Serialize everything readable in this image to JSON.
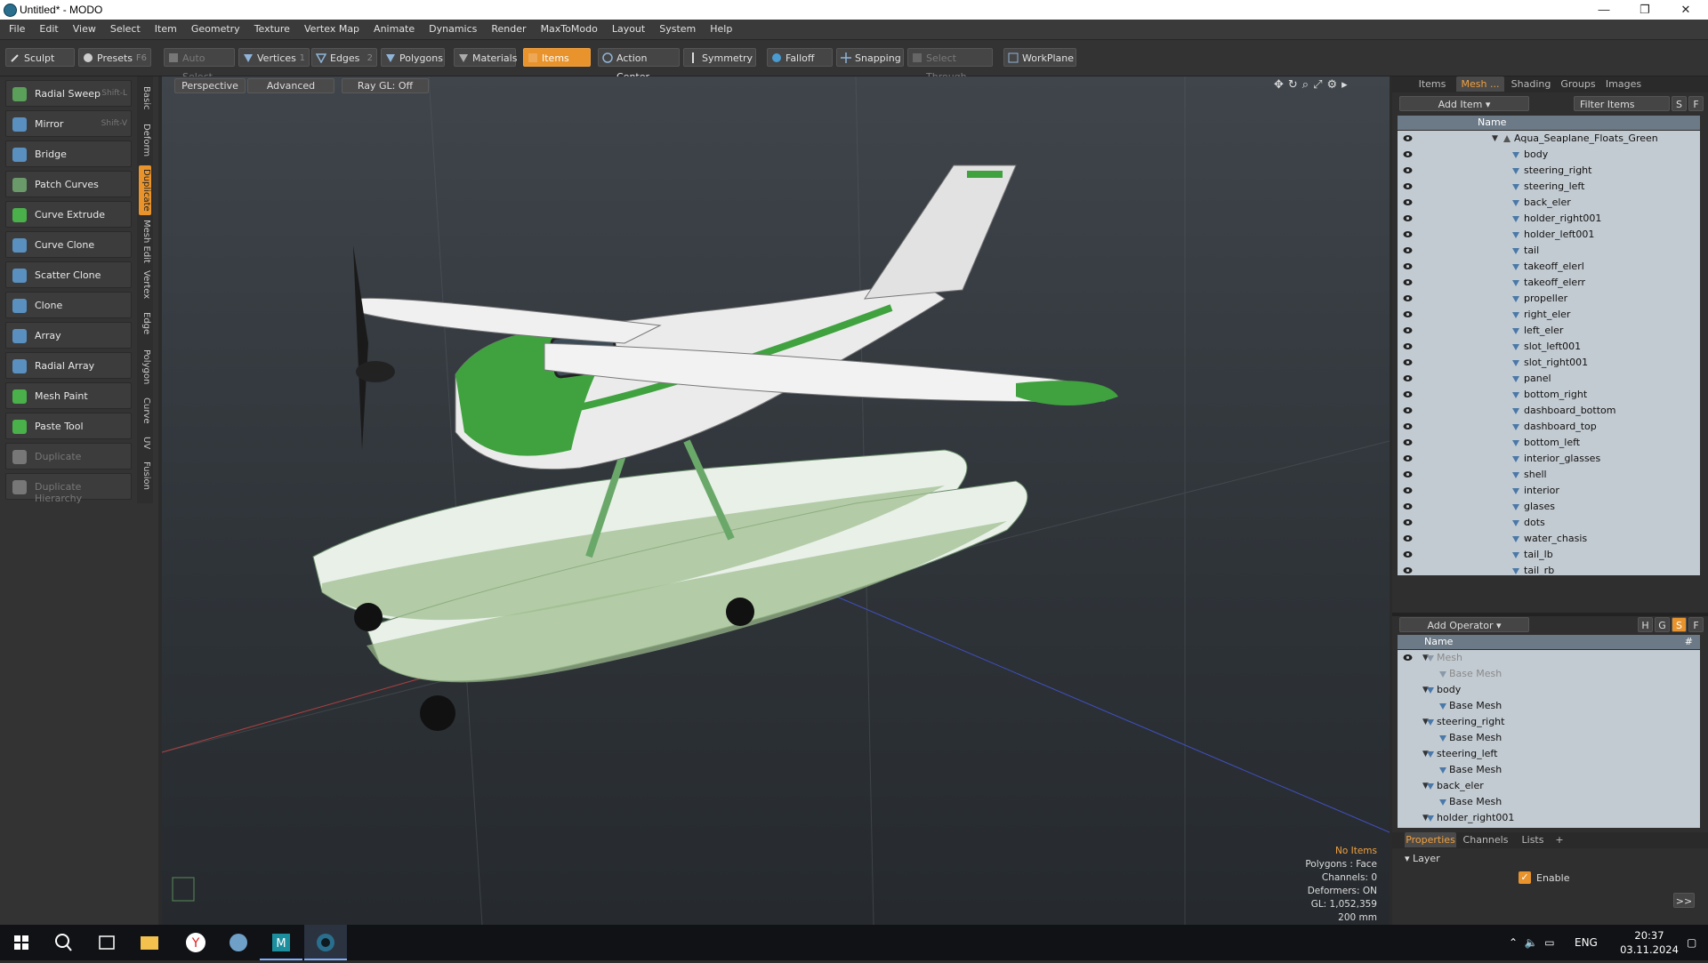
{
  "window": {
    "title": "Untitled* - MODO",
    "min_symbol": "—",
    "max_symbol": "❐",
    "close_symbol": "✕"
  },
  "menu": [
    "File",
    "Edit",
    "View",
    "Select",
    "Item",
    "Geometry",
    "Texture",
    "Vertex Map",
    "Animate",
    "Dynamics",
    "Render",
    "MaxToModo",
    "Layout",
    "System",
    "Help"
  ],
  "toolbar": {
    "sculpt": "Sculpt",
    "presets": "Presets",
    "presets_key": "F6",
    "auto_select": "Auto Select",
    "vertices": "Vertices",
    "vertices_key": "1",
    "edges": "Edges",
    "edges_key": "2",
    "polygons": "Polygons",
    "materials": "Materials",
    "items": "Items",
    "action_center": "Action Center",
    "symmetry": "Symmetry",
    "falloff": "Falloff",
    "snapping": "Snapping",
    "select_through": "Select Through",
    "workplane": "WorkPlane"
  },
  "tools": [
    {
      "label": "Radial Sweep",
      "key": "Shift-L",
      "icon": "radial-sweep-icon"
    },
    {
      "label": "Mirror",
      "key": "Shift-V",
      "icon": "mirror-icon"
    },
    {
      "label": "Bridge",
      "key": "",
      "icon": "bridge-icon"
    },
    {
      "label": "Patch Curves",
      "key": "",
      "icon": "patch-curves-icon"
    },
    {
      "label": "Curve Extrude",
      "key": "",
      "icon": "curve-extrude-icon"
    },
    {
      "label": "Curve Clone",
      "key": "",
      "icon": "curve-clone-icon"
    },
    {
      "label": "Scatter Clone",
      "key": "",
      "icon": "scatter-clone-icon"
    },
    {
      "label": "Clone",
      "key": "",
      "icon": "clone-icon"
    },
    {
      "label": "Array",
      "key": "",
      "icon": "array-icon"
    },
    {
      "label": "Radial Array",
      "key": "",
      "icon": "radial-array-icon"
    },
    {
      "label": "Mesh Paint",
      "key": "",
      "icon": "mesh-paint-icon"
    },
    {
      "label": "Paste Tool",
      "key": "",
      "icon": "paste-tool-icon"
    },
    {
      "label": "Duplicate",
      "key": "",
      "icon": "duplicate-icon"
    },
    {
      "label": "Duplicate Hierarchy",
      "key": "",
      "icon": "duplicate-hierarchy-icon"
    }
  ],
  "side_tabs": [
    "Basic",
    "Deform",
    "Duplicate",
    "Mesh Edit",
    "Vertex",
    "Edge",
    "Polygon",
    "Curve",
    "UV",
    "Fusion"
  ],
  "viewport": {
    "view": "Perspective",
    "mode": "Advanced",
    "raygl": "Ray GL: Off",
    "info": {
      "items": "No Items",
      "polygons": "Polygons : Face",
      "channels": "Channels: 0",
      "deformers": "Deformers: ON",
      "gl": "GL: 1,052,359",
      "scale": "200 mm"
    }
  },
  "right_tabs": [
    "Items",
    "Mesh ...",
    "Shading",
    "Groups",
    "Images"
  ],
  "items_panel": {
    "add_item": "Add Item",
    "filter": "Filter Items",
    "s_btn": "S",
    "f_btn": "F",
    "name_header": "Name",
    "root": "Aqua_Seaplane_Floats_Green",
    "children": [
      "body",
      "steering_right",
      "steering_left",
      "back_eler",
      "holder_right001",
      "holder_left001",
      "tail",
      "takeoff_elerl",
      "takeoff_elerr",
      "propeller",
      "right_eler",
      "left_eler",
      "slot_left001",
      "slot_right001",
      "panel",
      "bottom_right",
      "dashboard_bottom",
      "dashboard_top",
      "bottom_left",
      "interior_glasses",
      "shell",
      "interior",
      "glases",
      "dots",
      "water_chasis",
      "tail_lb",
      "tail_rb"
    ]
  },
  "operator_panel": {
    "add_operator": "Add Operator",
    "name_header": "Name",
    "hash_header": "#",
    "h_btn": "H",
    "g_btn": "G",
    "s_btn": "S",
    "f_btn": "F",
    "rows": [
      {
        "label": "Mesh",
        "level": 0,
        "dim": true
      },
      {
        "label": "Base Mesh",
        "level": 1,
        "dim": true
      },
      {
        "label": "body",
        "level": 0,
        "dim": false
      },
      {
        "label": "Base Mesh",
        "level": 1,
        "dim": false
      },
      {
        "label": "steering_right",
        "level": 0,
        "dim": false
      },
      {
        "label": "Base Mesh",
        "level": 1,
        "dim": false
      },
      {
        "label": "steering_left",
        "level": 0,
        "dim": false
      },
      {
        "label": "Base Mesh",
        "level": 1,
        "dim": false
      },
      {
        "label": "back_eler",
        "level": 0,
        "dim": false
      },
      {
        "label": "Base Mesh",
        "level": 1,
        "dim": false
      },
      {
        "label": "holder_right001",
        "level": 0,
        "dim": false
      }
    ]
  },
  "properties_panel": {
    "tabs": [
      "Properties",
      "Channels",
      "Lists",
      "+"
    ],
    "section": "Layer",
    "enable": "Enable",
    "more": ">>"
  },
  "taskbar": {
    "lang": "ENG",
    "time": "20:37",
    "date": "03.11.2024"
  },
  "colors": {
    "accent": "#e8932c",
    "list_bg": "#c3cbd2",
    "header": "#6c7a87"
  }
}
